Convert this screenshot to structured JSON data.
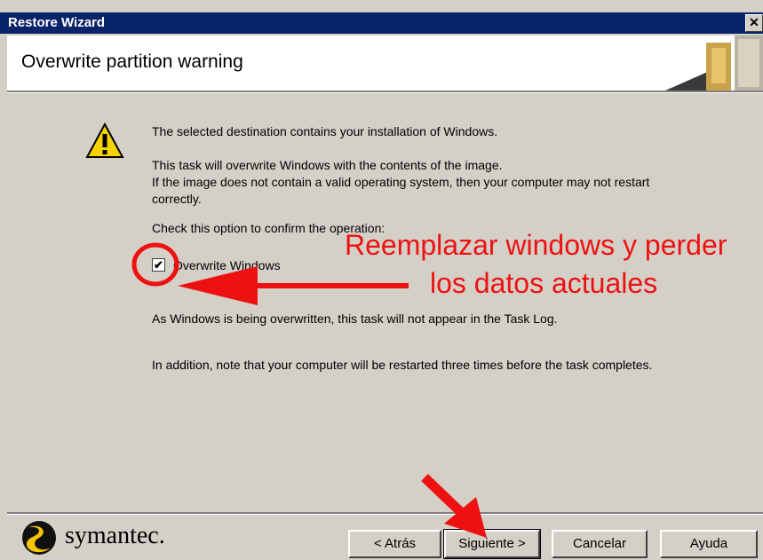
{
  "window": {
    "title": "Restore Wizard",
    "close_glyph": "✕"
  },
  "header": {
    "title": "Overwrite partition warning"
  },
  "content": {
    "line1": "The selected destination contains your installation of Windows.",
    "line2a": "This task will overwrite Windows with the contents of the image.",
    "line2b": "If the image does not contain a valid operating system, then your computer may not restart",
    "line2c": "correctly.",
    "confirm_prompt": "Check this option to confirm the operation:",
    "checkbox_label": "Overwrite Windows",
    "checkbox_checked": true,
    "checkbox_glyph": "✔",
    "note1": "As Windows is being overwritten, this task will not appear in the Task Log.",
    "note2": "In addition, note that your computer will be restarted three times before the task completes."
  },
  "annotation": {
    "line1": "Reemplazar windows y perder",
    "line2": "los datos actuales",
    "color": "#ee1111"
  },
  "footer": {
    "brand": "symantec.",
    "back_label": "< Atrás",
    "next_label": "Siguiente >",
    "cancel_label": "Cancelar",
    "help_label": "Ayuda"
  },
  "icons": {
    "warning": "warning-icon",
    "logo": "symantec-logo-icon"
  }
}
